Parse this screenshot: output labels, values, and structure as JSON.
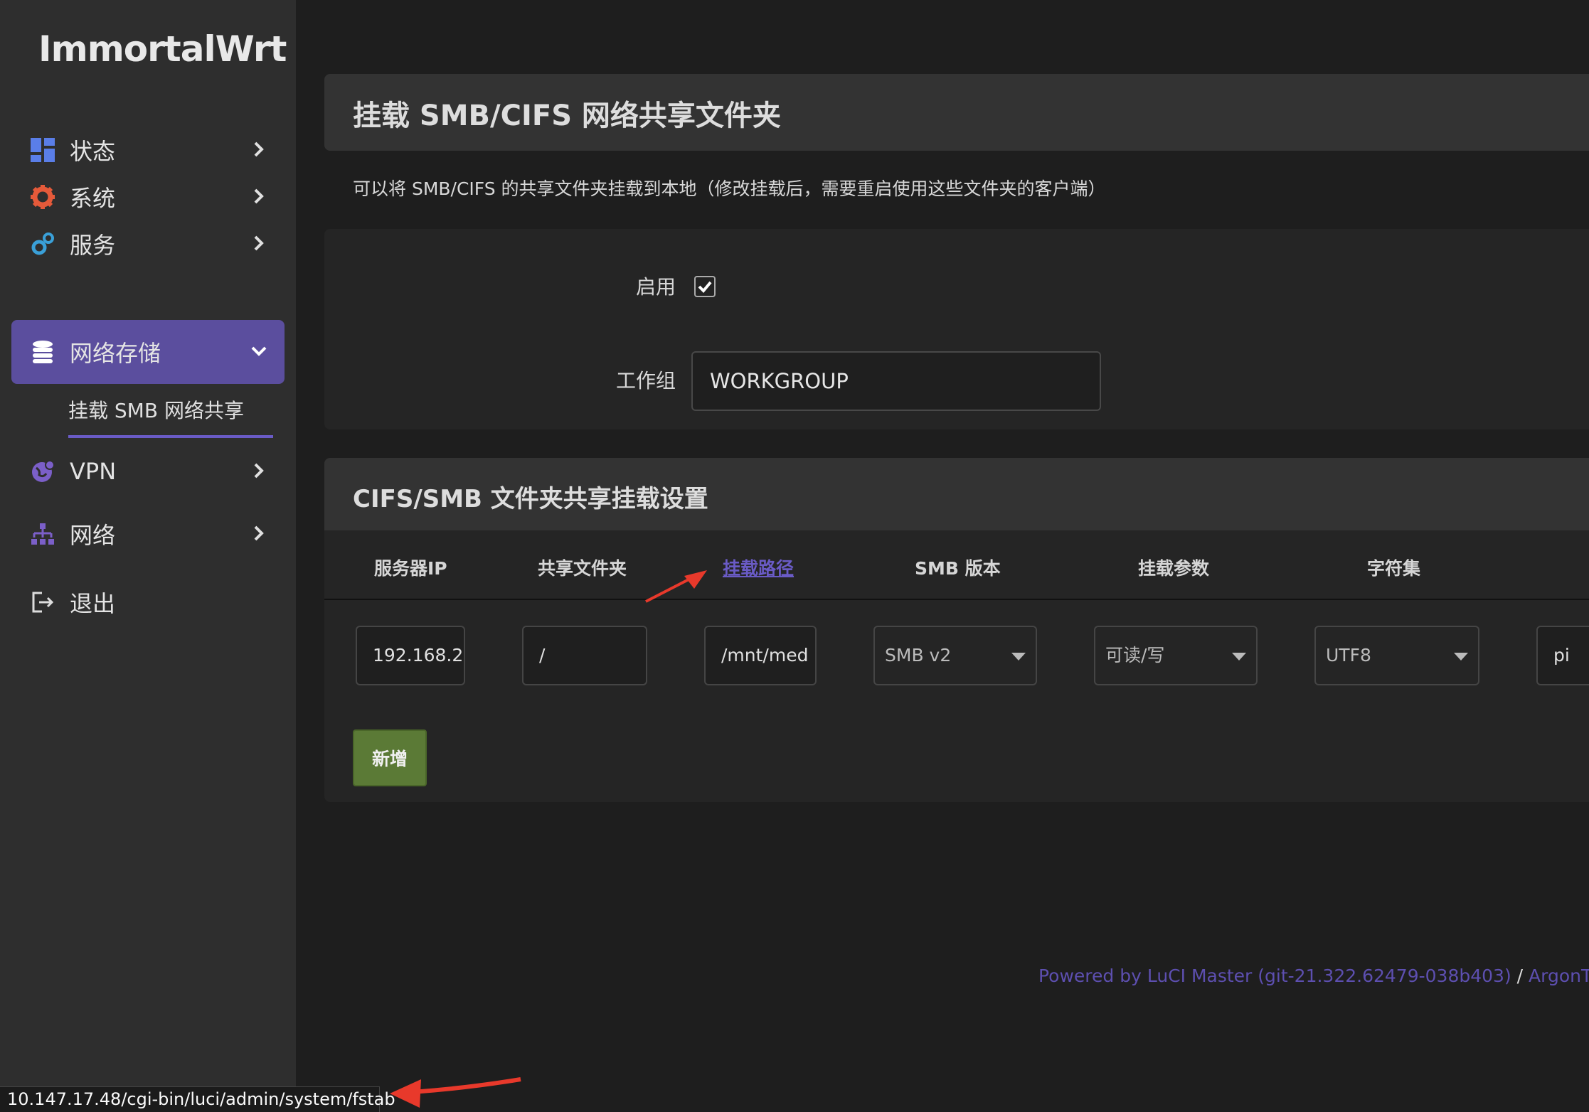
{
  "brand": "ImmortalWrt",
  "sidebar": {
    "items": [
      {
        "label": "状态",
        "icon": "dashboard-icon"
      },
      {
        "label": "系统",
        "icon": "gear-icon"
      },
      {
        "label": "服务",
        "icon": "cogs-icon"
      },
      {
        "label": "网络存储",
        "icon": "database-icon"
      },
      {
        "label": "VPN",
        "icon": "globe-icon"
      },
      {
        "label": "网络",
        "icon": "sitemap-icon"
      },
      {
        "label": "退出",
        "icon": "logout-icon"
      }
    ],
    "sub_item": "挂载 SMB 网络共享"
  },
  "page": {
    "title": "挂载 SMB/CIFS 网络共享文件夹",
    "description": "可以将 SMB/CIFS 的共享文件夹挂载到本地（修改挂载后，需要重启使用这些文件夹的客户端）"
  },
  "general": {
    "enable_label": "启用",
    "enabled": true,
    "workgroup_label": "工作组",
    "workgroup_value": "WORKGROUP"
  },
  "mounts": {
    "title": "CIFS/SMB 文件夹共享挂载设置",
    "headers": [
      "服务器IP",
      "共享文件夹",
      "挂载路径",
      "SMB 版本",
      "挂载参数",
      "字符集"
    ],
    "row": {
      "server": "192.168.2.",
      "share": "/",
      "mount_path": "/mnt/med",
      "smb_version": "SMB v2",
      "options": "可读/写",
      "charset": "UTF8",
      "user": "pi"
    },
    "add_label": "新增"
  },
  "footer": {
    "luci": "Powered by LuCI Master (git-21.322.62479-038b403)",
    "sep": "/",
    "theme": "ArgonTheme"
  },
  "status_url": "10.147.17.48/cgi-bin/luci/admin/system/fstab",
  "colors": {
    "accent": "#5b4e9e",
    "add_button": "#5b7a36",
    "arrow": "#e8392b"
  }
}
